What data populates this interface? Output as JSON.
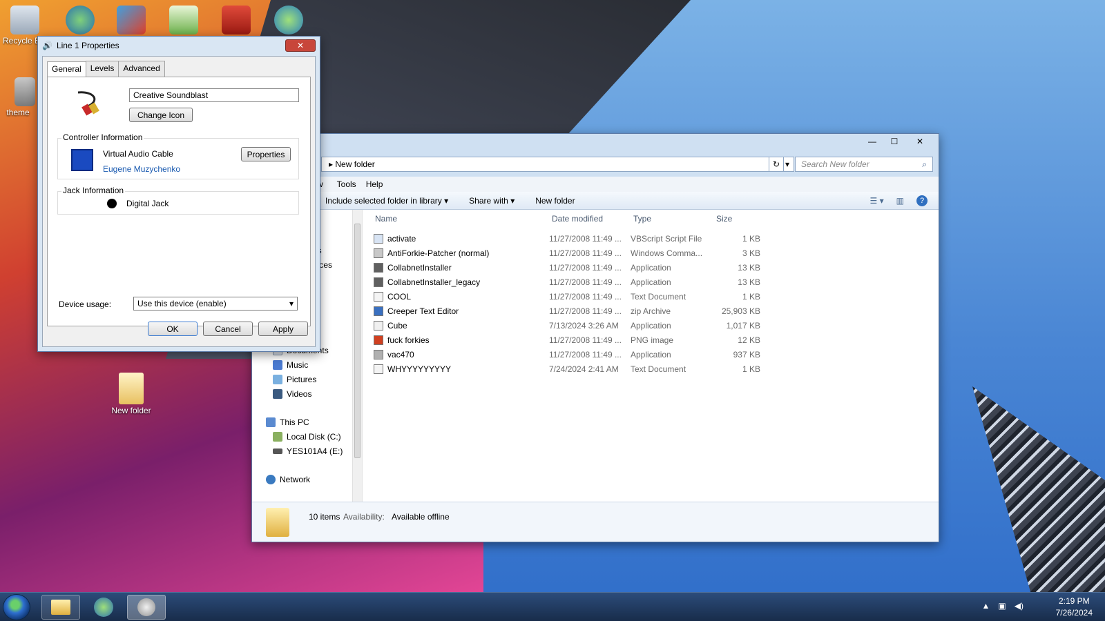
{
  "desktop": {
    "icons": [
      {
        "label": "Recycle Bin"
      },
      {
        "label": "theme"
      },
      {
        "label": "New folder"
      }
    ]
  },
  "props_dialog": {
    "title": "Line 1 Properties",
    "close_glyph": "✕",
    "tabs": [
      "General",
      "Levels",
      "Advanced"
    ],
    "device_name": "Creative Soundblast",
    "change_icon_label": "Change Icon",
    "controller_label": "Controller Information",
    "controller_name": "Virtual Audio Cable",
    "controller_vendor": "Eugene Muzychenko",
    "properties_label": "Properties",
    "jack_label": "Jack Information",
    "jack_name": "Digital Jack",
    "device_usage_label": "Device usage:",
    "device_usage_value": "Use this device (enable)",
    "ok_label": "OK",
    "cancel_label": "Cancel",
    "apply_label": "Apply"
  },
  "explorer": {
    "breadcrumb": "New folder",
    "search_placeholder": "Search New folder",
    "menu": [
      "w",
      "Tools",
      "Help"
    ],
    "commands": {
      "include": "Include selected folder in library",
      "share": "Share with",
      "new_folder": "New folder"
    },
    "nav": {
      "partial1": "ds",
      "partial2": "laces",
      "partial3": "p",
      "documents": "Documents",
      "music": "Music",
      "pictures": "Pictures",
      "videos": "Videos",
      "this_pc": "This PC",
      "local_disk": "Local Disk (C:)",
      "usb": "YES101A4 (E:)",
      "network": "Network"
    },
    "columns": {
      "name": "Name",
      "date": "Date modified",
      "type": "Type",
      "size": "Size"
    },
    "files": [
      {
        "name": "activate",
        "date": "11/27/2008 11:49 ...",
        "type": "VBScript Script File",
        "size": "1 KB"
      },
      {
        "name": "AntiForkie-Patcher (normal)",
        "date": "11/27/2008 11:49 ...",
        "type": "Windows Comma...",
        "size": "3 KB"
      },
      {
        "name": "CollabnetInstaller",
        "date": "11/27/2008 11:49 ...",
        "type": "Application",
        "size": "13 KB"
      },
      {
        "name": "CollabnetInstaller_legacy",
        "date": "11/27/2008 11:49 ...",
        "type": "Application",
        "size": "13 KB"
      },
      {
        "name": "COOL",
        "date": "11/27/2008 11:49 ...",
        "type": "Text Document",
        "size": "1 KB"
      },
      {
        "name": "Creeper Text Editor",
        "date": "11/27/2008 11:49 ...",
        "type": "zip Archive",
        "size": "25,903 KB"
      },
      {
        "name": "Cube",
        "date": "7/13/2024 3:26 AM",
        "type": "Application",
        "size": "1,017 KB"
      },
      {
        "name": "fuck forkies",
        "date": "11/27/2008 11:49 ...",
        "type": "PNG image",
        "size": "12 KB"
      },
      {
        "name": "vac470",
        "date": "11/27/2008 11:49 ...",
        "type": "Application",
        "size": "937 KB"
      },
      {
        "name": "WHYYYYYYYYY",
        "date": "7/24/2024 2:41 AM",
        "type": "Text Document",
        "size": "1 KB"
      }
    ],
    "status": {
      "count": "10 items",
      "availability_label": "Availability:",
      "availability_value": "Available offline"
    }
  },
  "taskbar": {
    "time": "2:19 PM",
    "date": "7/26/2024"
  }
}
